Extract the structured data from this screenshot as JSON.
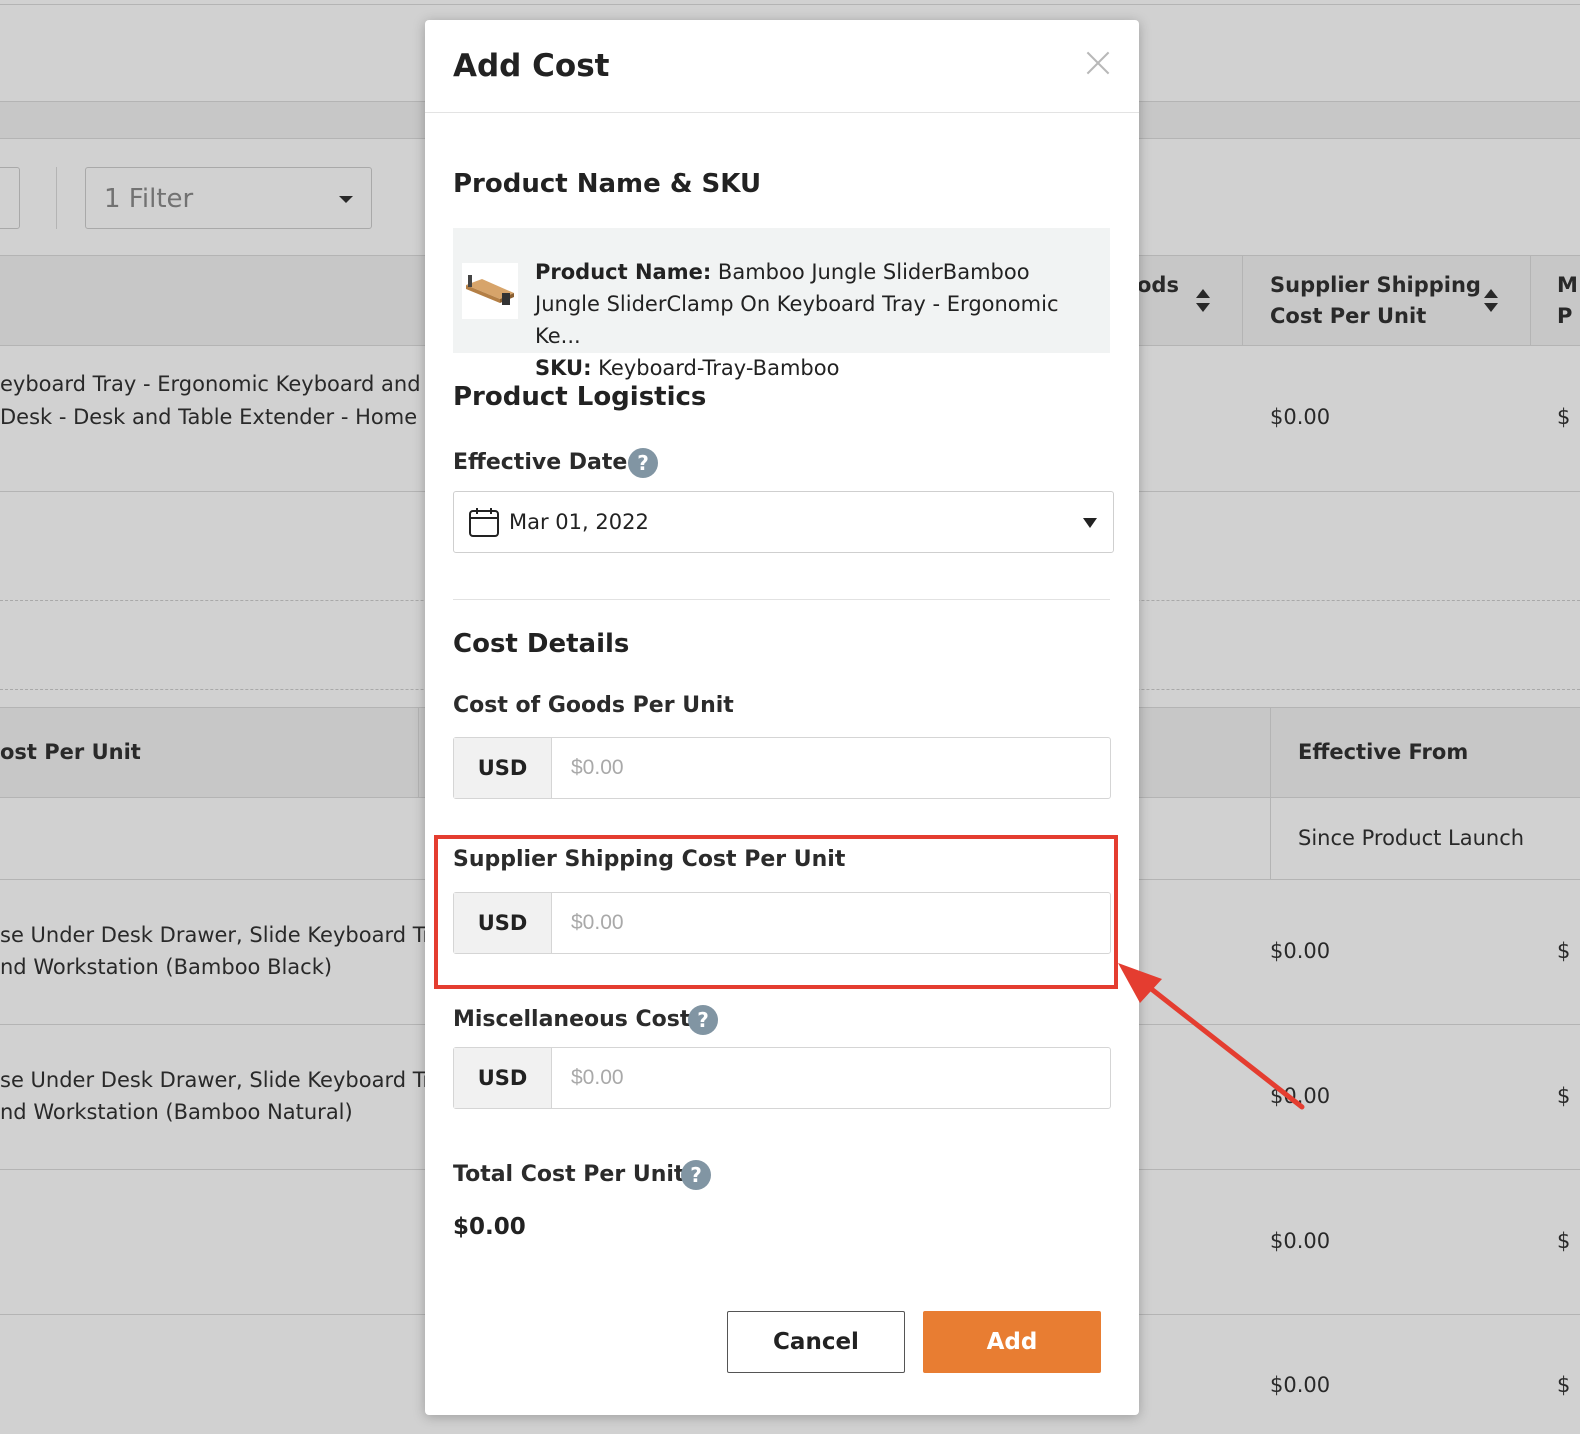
{
  "background": {
    "filter": {
      "label": "1 Filter"
    },
    "table1": {
      "headers": {
        "cogs_partial": "ods",
        "supplier_shipping_line1": "Supplier Shipping",
        "supplier_shipping_line2": "Cost Per Unit",
        "next_col_line1": "M",
        "next_col_line2": "P"
      },
      "row": {
        "name_line1": "eyboard Tray - Ergonomic Keyboard and",
        "name_line2": "Desk - Desk and Table Extender - Home",
        "shipping": "$0.00",
        "next": "$"
      }
    },
    "table2": {
      "headers": {
        "cost_per_unit": "ost Per Unit",
        "effective_from": "Effective From"
      },
      "first_row_effective": "Since Product Launch",
      "rows": [
        {
          "line1": "se Under Desk Drawer, Slide Keyboard Tr",
          "line2": "nd Workstation (Bamboo Black)",
          "shipping": "$0.00",
          "next": "$"
        },
        {
          "line1": "se Under Desk Drawer, Slide Keyboard Tr",
          "line2": "nd Workstation (Bamboo Natural)",
          "shipping": "$0.00",
          "next": "$"
        },
        {
          "line1": "",
          "line2": "",
          "shipping": "$0.00",
          "next": "$"
        },
        {
          "line1": "",
          "line2": "",
          "shipping": "$0.00",
          "next": "$"
        }
      ]
    }
  },
  "modal": {
    "title": "Add Cost",
    "product_section": {
      "title": "Product Name & SKU",
      "name_label": "Product Name:",
      "name_value": "Bamboo Jungle SliderBamboo Jungle SliderClamp On Keyboard Tray - Ergonomic Ke...",
      "sku_label": "SKU:",
      "sku_value": "Keyboard-Tray-Bamboo"
    },
    "logistics_section": {
      "title": "Product Logistics",
      "effective_date_label": "Effective Date",
      "effective_date_value": "Mar 01, 2022"
    },
    "cost_section": {
      "title": "Cost Details",
      "cogs": {
        "label": "Cost of Goods Per Unit",
        "currency": "USD",
        "placeholder": "$0.00"
      },
      "supplier_shipping": {
        "label": "Supplier Shipping Cost Per Unit",
        "currency": "USD",
        "placeholder": "$0.00"
      },
      "misc": {
        "label": "Miscellaneous Cost",
        "currency": "USD",
        "placeholder": "$0.00"
      },
      "total": {
        "label": "Total Cost Per Unit",
        "value": "$0.00"
      }
    },
    "buttons": {
      "cancel": "Cancel",
      "add": "Add"
    }
  },
  "annotation": {
    "highlight_color": "#e43d30"
  },
  "colors": {
    "accent": "#e87d32",
    "help_icon": "#8195a3"
  }
}
